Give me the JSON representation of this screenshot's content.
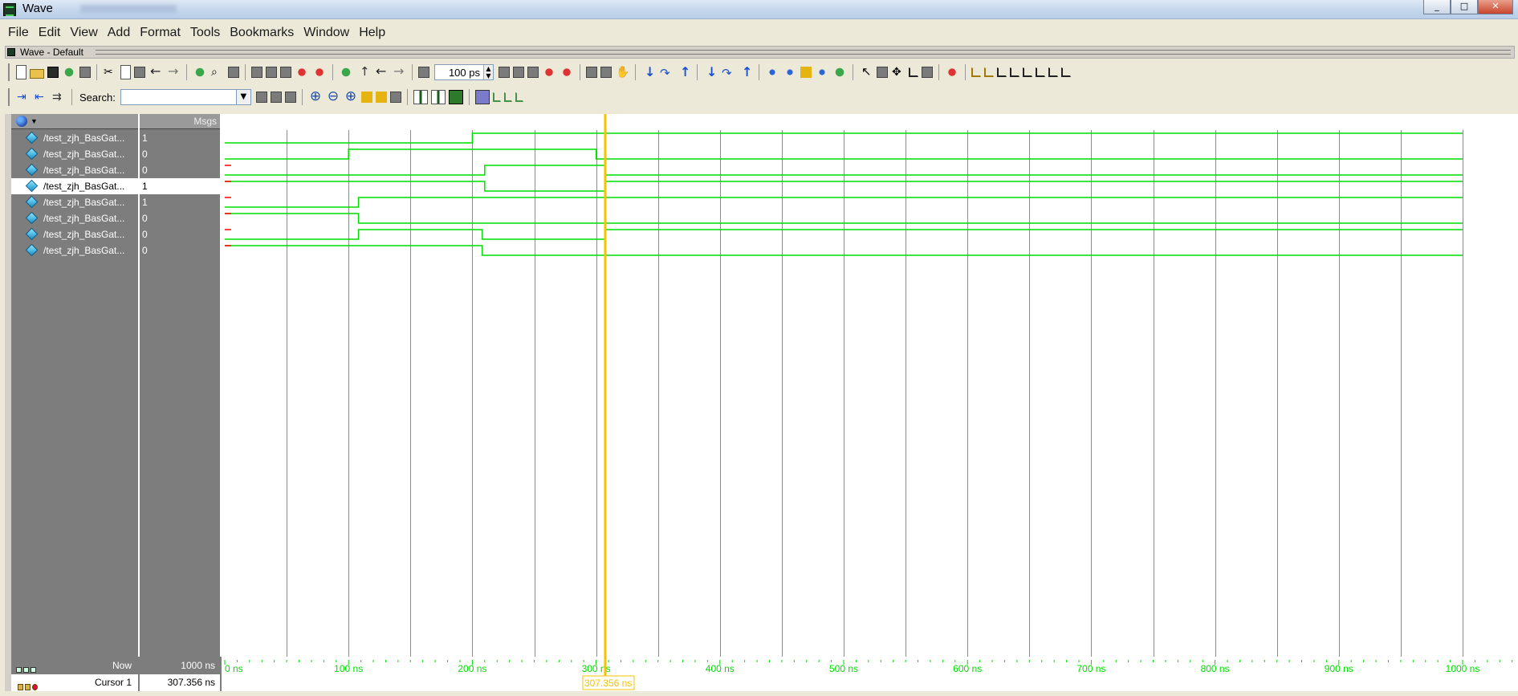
{
  "window": {
    "title": "Wave",
    "buttons": [
      "_",
      "□",
      "✕"
    ]
  },
  "menu": [
    "File",
    "Edit",
    "View",
    "Add",
    "Format",
    "Tools",
    "Bookmarks",
    "Window",
    "Help"
  ],
  "subwindow": {
    "title": "Wave - Default"
  },
  "toolbar": {
    "run_length": {
      "value": "100",
      "unit": "ps"
    },
    "search_label": "Search:",
    "search_value": ""
  },
  "headers": {
    "messages": "Msgs"
  },
  "signals": [
    {
      "name": "/test_zjh_BasGat...",
      "value": "1",
      "selected": false
    },
    {
      "name": "/test_zjh_BasGat...",
      "value": "0",
      "selected": false
    },
    {
      "name": "/test_zjh_BasGat...",
      "value": "0",
      "selected": false
    },
    {
      "name": "/test_zjh_BasGat...",
      "value": "1",
      "selected": true
    },
    {
      "name": "/test_zjh_BasGat...",
      "value": "1",
      "selected": false
    },
    {
      "name": "/test_zjh_BasGat...",
      "value": "0",
      "selected": false
    },
    {
      "name": "/test_zjh_BasGat...",
      "value": "0",
      "selected": false
    },
    {
      "name": "/test_zjh_BasGat...",
      "value": "0",
      "selected": false
    }
  ],
  "waveforms": [
    {
      "transitions": [
        [
          0,
          0
        ],
        [
          200,
          1
        ],
        [
          1000,
          1
        ]
      ]
    },
    {
      "transitions": [
        [
          0,
          0
        ],
        [
          100,
          1
        ],
        [
          300,
          0
        ],
        [
          1000,
          0
        ]
      ]
    },
    {
      "transitions": [
        [
          0,
          0
        ],
        [
          210,
          1
        ],
        [
          307,
          0
        ],
        [
          1000,
          0
        ]
      ]
    },
    {
      "transitions": [
        [
          0,
          1
        ],
        [
          210,
          0
        ],
        [
          307,
          1
        ],
        [
          1000,
          1
        ]
      ]
    },
    {
      "transitions": [
        [
          0,
          0
        ],
        [
          108,
          1
        ],
        [
          1000,
          1
        ]
      ]
    },
    {
      "transitions": [
        [
          0,
          1
        ],
        [
          108,
          0
        ],
        [
          1000,
          0
        ]
      ]
    },
    {
      "transitions": [
        [
          0,
          0
        ],
        [
          108,
          1
        ],
        [
          208,
          0
        ],
        [
          307,
          1
        ],
        [
          1000,
          1
        ]
      ]
    },
    {
      "transitions": [
        [
          0,
          1
        ],
        [
          208,
          0
        ],
        [
          1000,
          0
        ]
      ]
    }
  ],
  "time_axis": {
    "unit": "ns",
    "start": 0,
    "end": 1000,
    "major_step": 100,
    "grid_step": 50,
    "tick_labels": [
      "0 ns",
      "100 ns",
      "200 ns",
      "300 ns",
      "400 ns",
      "500 ns",
      "600 ns",
      "700 ns",
      "800 ns",
      "900 ns",
      "1000 ns"
    ]
  },
  "status": {
    "now_label": "Now",
    "now_value": "1000 ns",
    "cursor_label": "Cursor 1",
    "cursor_value": "307.356 ns",
    "cursor_time": 307.356
  },
  "colors": {
    "wave": "#00dd00",
    "grid": "#8c8c8c",
    "cursor": "#f5c400",
    "glitch": "#ff0000"
  }
}
